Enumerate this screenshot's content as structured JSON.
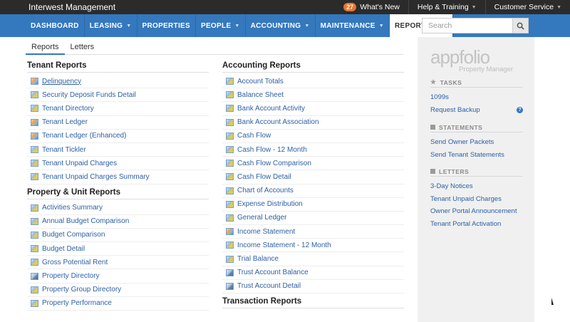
{
  "topbar": {
    "brand": "Interwest Management",
    "whats_new_count": "27",
    "whats_new": "What's New",
    "help": "Help & Training",
    "customer_service": "Customer Service"
  },
  "nav": {
    "items": [
      "DASHBOARD",
      "LEASING",
      "PROPERTIES",
      "PEOPLE",
      "ACCOUNTING",
      "MAINTENANCE",
      "REPORTING"
    ],
    "active": "REPORTING"
  },
  "search": {
    "placeholder": "Search"
  },
  "tabs": [
    "Reports",
    "Letters"
  ],
  "tenant_reports": {
    "title": "Tenant Reports",
    "items": [
      "Delinquency",
      "Security Deposit Funds Detail",
      "Tenant Directory",
      "Tenant Ledger",
      "Tenant Ledger (Enhanced)",
      "Tenant Tickler",
      "Tenant Unpaid Charges",
      "Tenant Unpaid Charges Summary"
    ]
  },
  "property_reports": {
    "title": "Property & Unit Reports",
    "items": [
      "Activities Summary",
      "Annual Budget Comparison",
      "Budget Comparison",
      "Budget Detail",
      "Gross Potential Rent",
      "Property Directory",
      "Property Group Directory",
      "Property Performance"
    ]
  },
  "accounting_reports": {
    "title": "Accounting Reports",
    "items": [
      "Account Totals",
      "Balance Sheet",
      "Bank Account Activity",
      "Bank Account Association",
      "Cash Flow",
      "Cash Flow - 12 Month",
      "Cash Flow Comparison",
      "Cash Flow Detail",
      "Chart of Accounts",
      "Expense Distribution",
      "General Ledger",
      "Income Statement",
      "Income Statement - 12 Month",
      "Trial Balance",
      "Trust Account Balance",
      "Trust Account Detail"
    ]
  },
  "transaction_reports": {
    "title": "Transaction Reports"
  },
  "sidebar": {
    "logo": "appfolio",
    "logo_sub": "Property Manager",
    "tasks_head": "TASKS",
    "tasks": [
      "1099s",
      "Request Backup"
    ],
    "statements_head": "STATEMENTS",
    "statements": [
      "Send Owner Packets",
      "Send Tenant Statements"
    ],
    "letters_head": "LETTERS",
    "letters": [
      "3-Day Notices",
      "Tenant Unpaid Charges",
      "Owner Portal Announcement",
      "Tenant Portal Activation"
    ]
  }
}
